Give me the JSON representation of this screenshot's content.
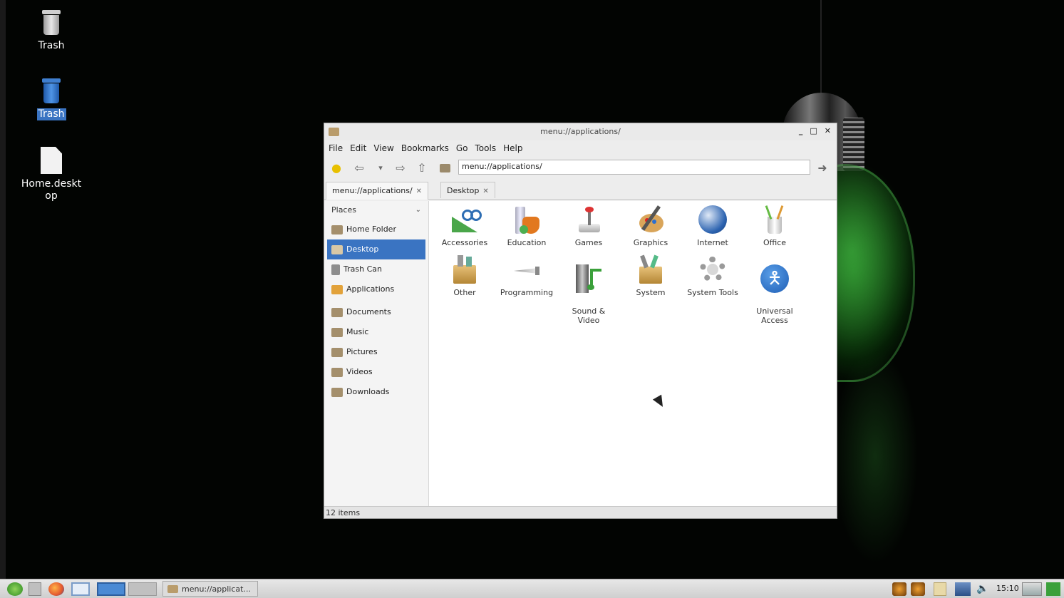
{
  "desktop": {
    "icons": [
      {
        "label": "Trash"
      },
      {
        "label": "Trash"
      },
      {
        "label": "Home.deskt\nop"
      }
    ]
  },
  "window": {
    "title": "menu://applications/",
    "menu": [
      "File",
      "Edit",
      "View",
      "Bookmarks",
      "Go",
      "Tools",
      "Help"
    ],
    "address": "menu://applications/",
    "tabs": [
      {
        "label": "menu://applications/"
      },
      {
        "label": "Desktop"
      }
    ],
    "sidebar": {
      "header": "Places",
      "items": [
        {
          "label": "Home Folder",
          "icon": "home-folder-icon"
        },
        {
          "label": "Desktop",
          "icon": "desktop-folder-icon"
        },
        {
          "label": "Trash Can",
          "icon": "trash-can-icon"
        },
        {
          "label": "Applications",
          "icon": "applications-icon"
        },
        {
          "label": "Documents",
          "icon": "documents-folder-icon"
        },
        {
          "label": "Music",
          "icon": "music-folder-icon"
        },
        {
          "label": "Pictures",
          "icon": "pictures-folder-icon"
        },
        {
          "label": "Videos",
          "icon": "videos-folder-icon"
        },
        {
          "label": "Downloads",
          "icon": "downloads-folder-icon"
        }
      ]
    },
    "apps": [
      {
        "label": "Accessories",
        "icon": "accessories-icon"
      },
      {
        "label": "Education",
        "icon": "education-icon"
      },
      {
        "label": "Games",
        "icon": "games-icon"
      },
      {
        "label": "Graphics",
        "icon": "graphics-icon"
      },
      {
        "label": "Internet",
        "icon": "internet-icon"
      },
      {
        "label": "Office",
        "icon": "office-icon"
      },
      {
        "label": "Other",
        "icon": "other-icon"
      },
      {
        "label": "Programming",
        "icon": "programming-icon"
      },
      {
        "label": "Sound &\nVideo",
        "icon": "sound-video-icon"
      },
      {
        "label": "System",
        "icon": "system-icon"
      },
      {
        "label": "System Tools",
        "icon": "system-tools-icon"
      },
      {
        "label": "Universal\nAccess",
        "icon": "universal-access-icon"
      }
    ],
    "status": "12 items"
  },
  "taskbar": {
    "task_label": "menu://applicat...",
    "clock": "15:10"
  },
  "colors": {
    "selection": "#3a74c2",
    "window_bg": "#ededed",
    "desktop_bg": "#020402",
    "bulb_green": "#3caa3c"
  }
}
